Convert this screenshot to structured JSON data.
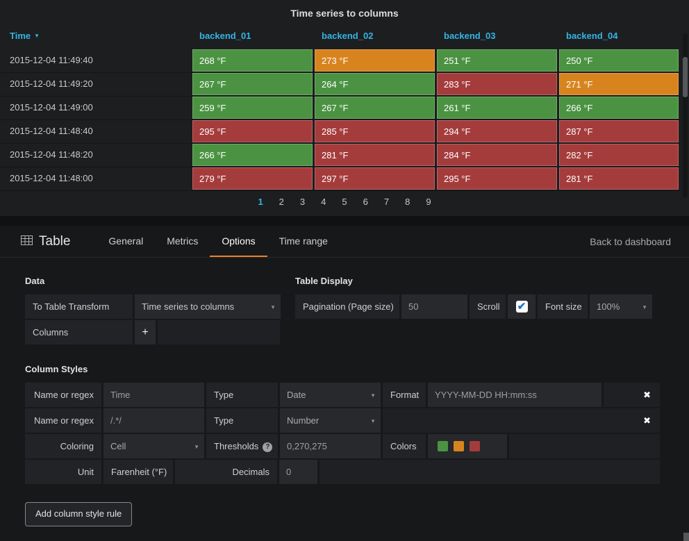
{
  "icons": {
    "sort_desc": "▼",
    "caret_down": "▼",
    "check": "✔",
    "close": "✖",
    "help": "?",
    "plus": "+"
  },
  "colors": {
    "cell_green": "#4b9342",
    "cell_orange": "#d8841e",
    "cell_red": "#a53c3c",
    "link_blue": "#33b5e5"
  },
  "panel": {
    "title": "Time series to columns",
    "columns": [
      "Time",
      "backend_01",
      "backend_02",
      "backend_03",
      "backend_04"
    ],
    "rows": [
      {
        "time": "2015-12-04 11:49:40",
        "cells": [
          {
            "v": "268 °F",
            "c": "green"
          },
          {
            "v": "273 °F",
            "c": "orange"
          },
          {
            "v": "251 °F",
            "c": "green"
          },
          {
            "v": "250 °F",
            "c": "green"
          }
        ]
      },
      {
        "time": "2015-12-04 11:49:20",
        "cells": [
          {
            "v": "267 °F",
            "c": "green"
          },
          {
            "v": "264 °F",
            "c": "green"
          },
          {
            "v": "283 °F",
            "c": "red"
          },
          {
            "v": "271 °F",
            "c": "orange"
          }
        ]
      },
      {
        "time": "2015-12-04 11:49:00",
        "cells": [
          {
            "v": "259 °F",
            "c": "green"
          },
          {
            "v": "267 °F",
            "c": "green"
          },
          {
            "v": "261 °F",
            "c": "green"
          },
          {
            "v": "266 °F",
            "c": "green"
          }
        ]
      },
      {
        "time": "2015-12-04 11:48:40",
        "cells": [
          {
            "v": "295 °F",
            "c": "red"
          },
          {
            "v": "285 °F",
            "c": "red"
          },
          {
            "v": "294 °F",
            "c": "red"
          },
          {
            "v": "287 °F",
            "c": "red"
          }
        ]
      },
      {
        "time": "2015-12-04 11:48:20",
        "cells": [
          {
            "v": "266 °F",
            "c": "green"
          },
          {
            "v": "281 °F",
            "c": "red"
          },
          {
            "v": "284 °F",
            "c": "red"
          },
          {
            "v": "282 °F",
            "c": "red"
          }
        ]
      },
      {
        "time": "2015-12-04 11:48:00",
        "cells": [
          {
            "v": "279 °F",
            "c": "red"
          },
          {
            "v": "297 °F",
            "c": "red"
          },
          {
            "v": "295 °F",
            "c": "red"
          },
          {
            "v": "281 °F",
            "c": "red"
          }
        ]
      }
    ],
    "pages": [
      "1",
      "2",
      "3",
      "4",
      "5",
      "6",
      "7",
      "8",
      "9"
    ],
    "active_page": "1"
  },
  "editor": {
    "panel_type": "Table",
    "tabs": [
      "General",
      "Metrics",
      "Options",
      "Time range"
    ],
    "active_tab": "Options",
    "back_link": "Back to dashboard",
    "data_section": {
      "heading": "Data",
      "transform_label": "To Table Transform",
      "transform_value": "Time series to columns",
      "columns_label": "Columns",
      "add_button": "+"
    },
    "display_section": {
      "heading": "Table Display",
      "pagination_label": "Pagination (Page size)",
      "pagination_value": "50",
      "scroll_label": "Scroll",
      "scroll_checked": true,
      "fontsize_label": "Font size",
      "fontsize_value": "100%"
    },
    "column_styles": {
      "heading": "Column Styles",
      "rows": [
        {
          "name_label": "Name or regex",
          "name_value": "Time",
          "type_label": "Type",
          "type_value": "Date",
          "format_label": "Format",
          "format_value": "YYYY-MM-DD HH:mm:ss"
        },
        {
          "name_label": "Name or regex",
          "name_value": "/.*/",
          "type_label": "Type",
          "type_value": "Number"
        },
        {
          "coloring_label": "Coloring",
          "coloring_value": "Cell",
          "thresholds_label": "Thresholds",
          "thresholds_value": "0,270,275",
          "colors_label": "Colors",
          "swatches": [
            "#4b9342",
            "#d8841e",
            "#a53c3c"
          ]
        },
        {
          "unit_label": "Unit",
          "unit_value": "Farenheit (°F)",
          "decimals_label": "Decimals",
          "decimals_value": "0"
        }
      ]
    },
    "add_rule_button": "Add column style rule"
  }
}
